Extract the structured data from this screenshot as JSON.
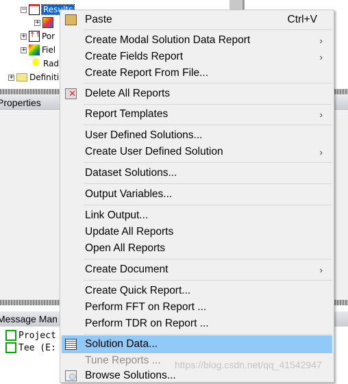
{
  "tree": {
    "items": [
      {
        "label": "Results",
        "selected": true
      },
      {
        "label": ""
      },
      {
        "label": "Por"
      },
      {
        "label": "Fiel"
      },
      {
        "label": "Rad"
      },
      {
        "label": "Definiti"
      }
    ]
  },
  "panels": {
    "properties": "Properties",
    "messages": "Message Man"
  },
  "messages": [
    {
      "label": "Project"
    },
    {
      "label": "Tee (E:"
    }
  ],
  "menu": {
    "items": [
      {
        "label": "Paste",
        "shortcut": "Ctrl+V",
        "icon": "paste-icon"
      },
      {
        "label": "Create Modal Solution Data Report",
        "submenu": true
      },
      {
        "label": "Create Fields Report",
        "submenu": true
      },
      {
        "label": "Create Report From File..."
      },
      {
        "label": "Delete All Reports",
        "icon": "delete-reports-icon"
      },
      {
        "label": "Report Templates",
        "submenu": true
      },
      {
        "label": "User Defined Solutions..."
      },
      {
        "label": "Create User Defined Solution",
        "submenu": true
      },
      {
        "label": "Dataset Solutions..."
      },
      {
        "label": "Output Variables..."
      },
      {
        "label": "Link Output..."
      },
      {
        "label": "Update All Reports"
      },
      {
        "label": "Open All Reports"
      },
      {
        "label": "Create Document",
        "submenu": true
      },
      {
        "label": "Create Quick Report..."
      },
      {
        "label": "Perform FFT on Report ..."
      },
      {
        "label": "Perform TDR on Report ..."
      },
      {
        "label": "Solution Data...",
        "highlighted": true,
        "icon": "solution-data-icon"
      },
      {
        "label": "Tune Reports ...",
        "disabled": true
      },
      {
        "label": "Browse Solutions...",
        "icon": "browse-solutions-icon"
      }
    ],
    "arrow": "›"
  },
  "watermark": "https://blog.csdn.net/qq_41542947",
  "colors": {
    "highlight": "#91c9f7",
    "menu_bg": "#f0f0f0",
    "selection": "#0a64d2"
  }
}
